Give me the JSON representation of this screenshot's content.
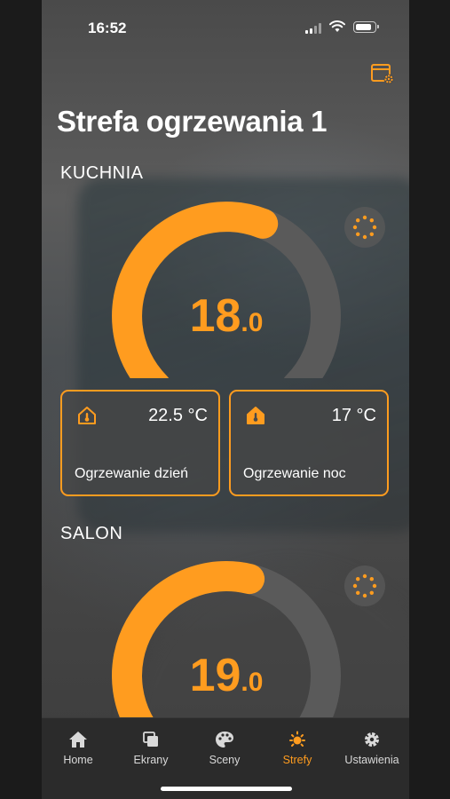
{
  "status": {
    "time": "16:52"
  },
  "header": {
    "title": "Strefa ogrzewania 1",
    "settings_icon": "window-gear-icon"
  },
  "zones": [
    {
      "name": "KUCHNIA",
      "temperature": {
        "integer": "18",
        "decimal": ".0"
      },
      "gauge_fill_fraction": 0.58,
      "presets": [
        {
          "icon": "heat-home-outline-icon",
          "value": "22.5 °C",
          "label": "Ogrzewanie dzień"
        },
        {
          "icon": "heat-home-filled-icon",
          "value": "17 °C",
          "label": "Ogrzewanie noc"
        }
      ]
    },
    {
      "name": "SALON",
      "temperature": {
        "integer": "19",
        "decimal": ".0"
      },
      "gauge_fill_fraction": 0.55
    }
  ],
  "tabs": [
    {
      "label": "Home",
      "icon": "home-icon",
      "active": false
    },
    {
      "label": "Ekrany",
      "icon": "screens-icon",
      "active": false
    },
    {
      "label": "Sceny",
      "icon": "palette-icon",
      "active": false
    },
    {
      "label": "Strefy",
      "icon": "zones-sun-icon",
      "active": true
    },
    {
      "label": "Ustawienia",
      "icon": "gear-icon",
      "active": false
    }
  ],
  "colors": {
    "accent": "#ff9c1f",
    "track": "#5a5a5a",
    "tabbar": "#2b2b2b"
  }
}
